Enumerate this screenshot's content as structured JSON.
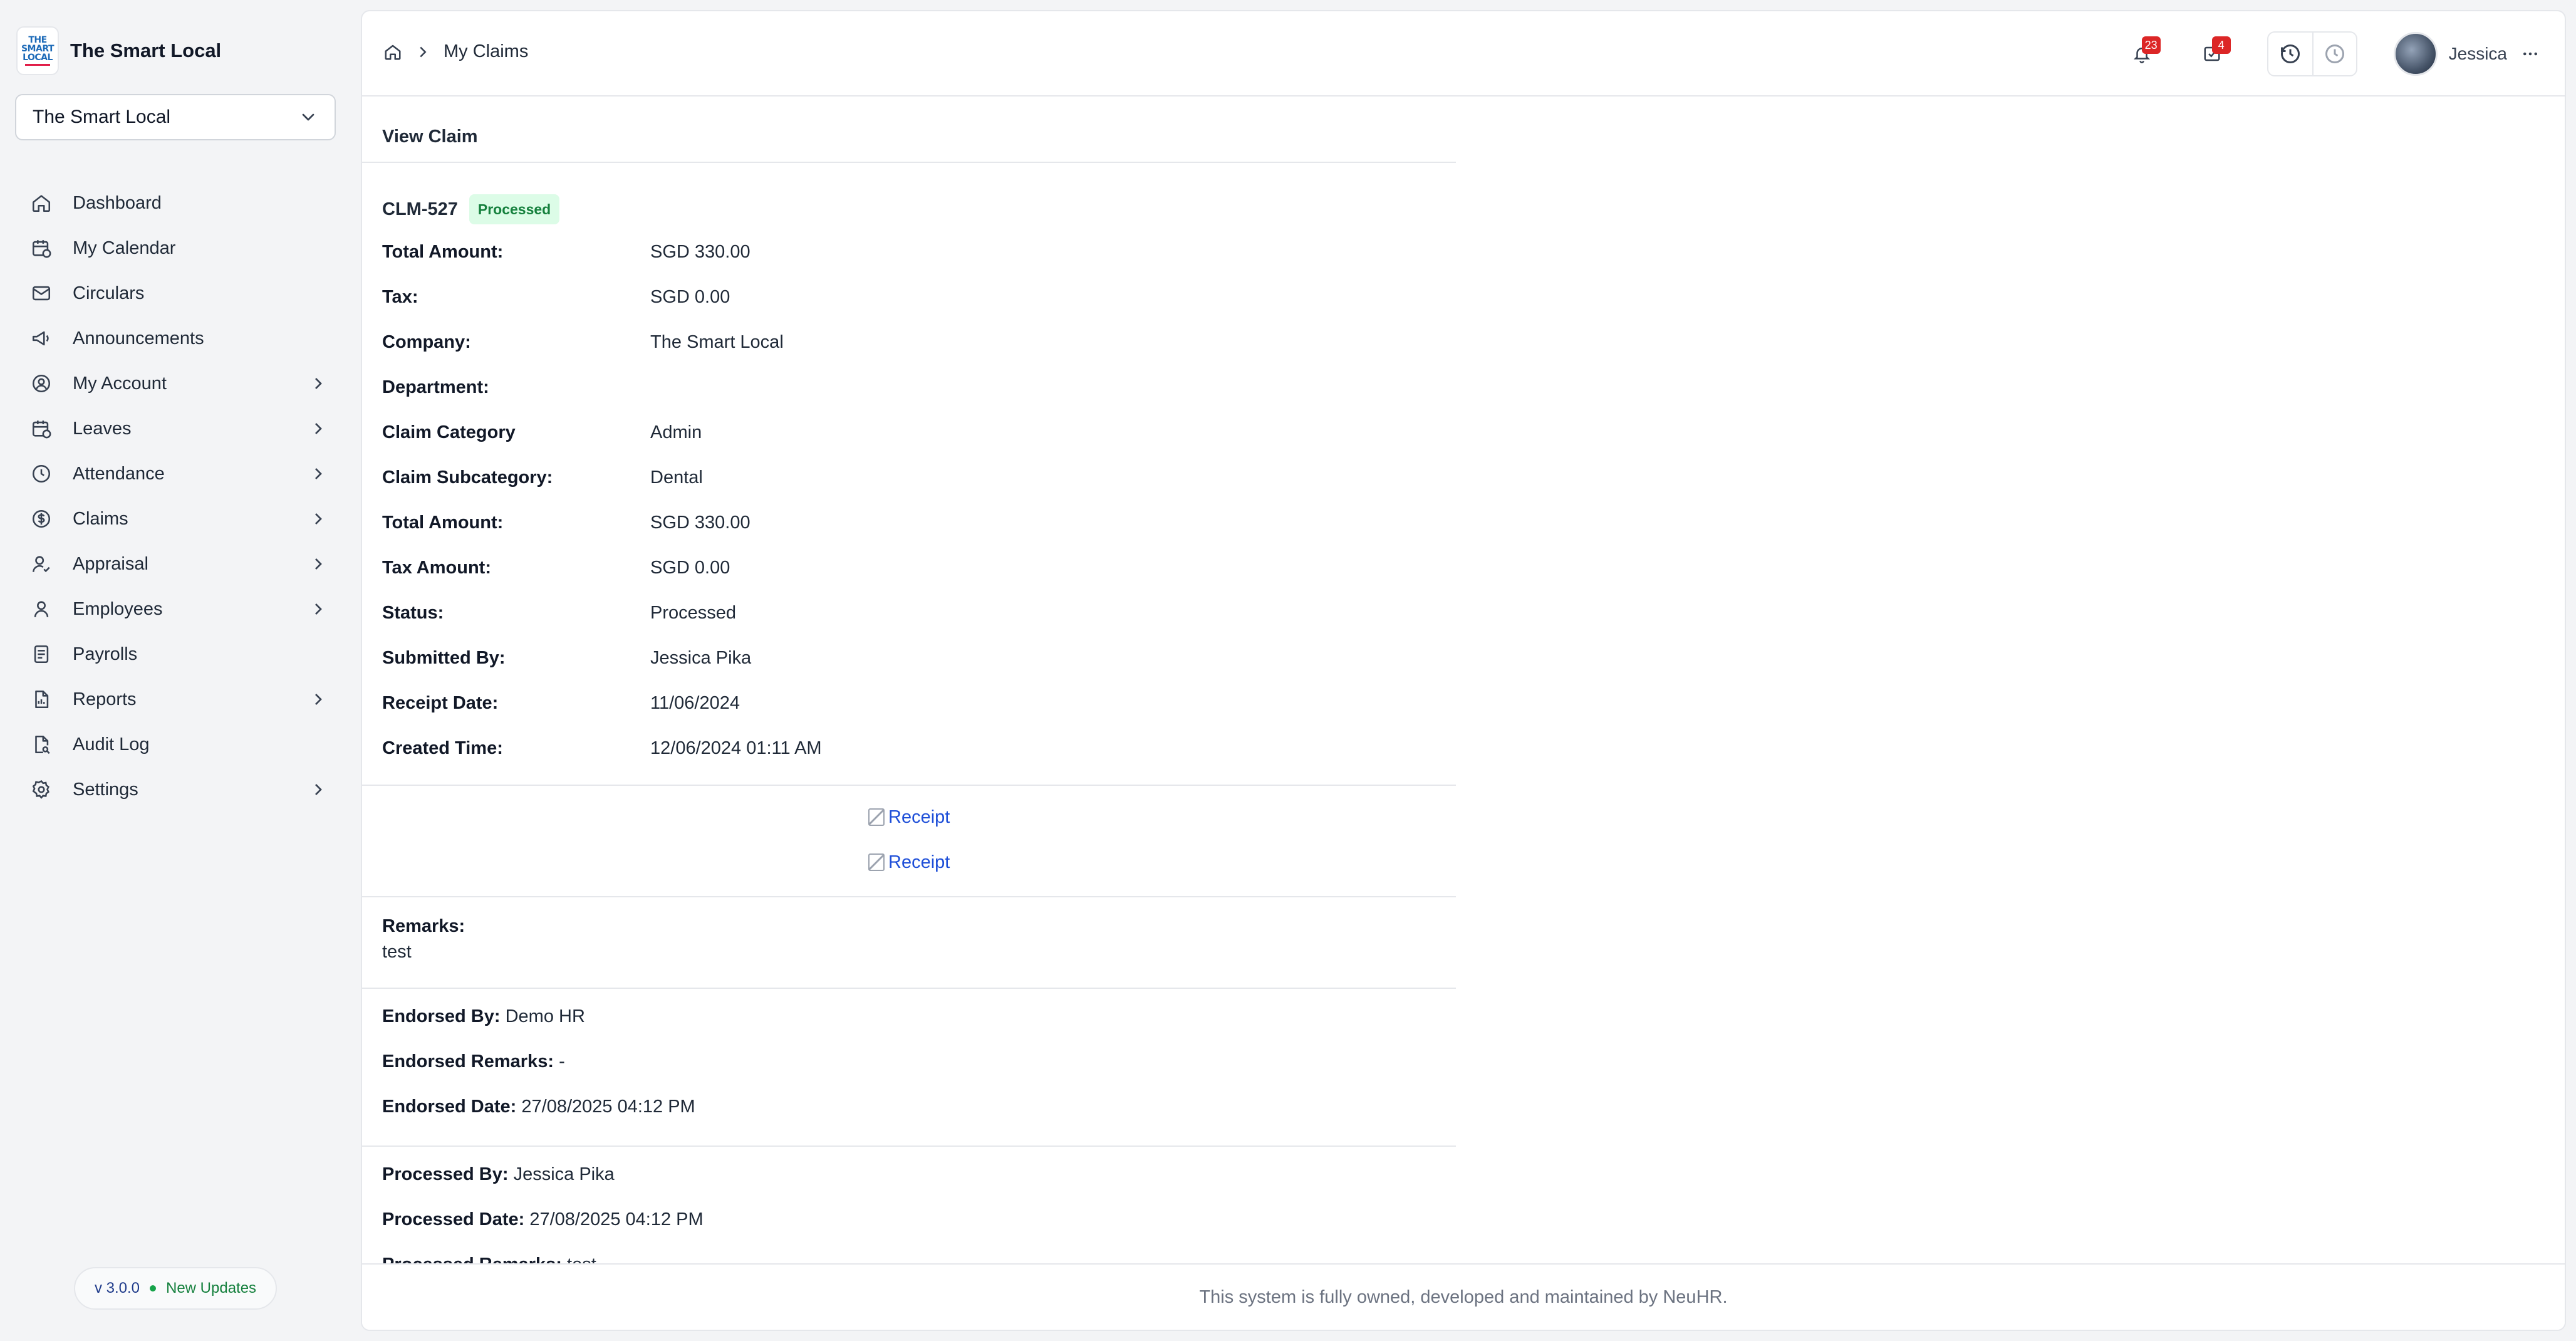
{
  "app": {
    "name": "The Smart Local",
    "logo_text": "THE SMART LOCAL"
  },
  "company_select": {
    "value": "The Smart Local"
  },
  "nav": [
    {
      "label": "Dashboard",
      "icon": "home-icon",
      "has_children": false
    },
    {
      "label": "My Calendar",
      "icon": "calendar-clock-icon",
      "has_children": false
    },
    {
      "label": "Circulars",
      "icon": "mail-icon",
      "has_children": false
    },
    {
      "label": "Announcements",
      "icon": "megaphone-icon",
      "has_children": false
    },
    {
      "label": "My Account",
      "icon": "user-circle-icon",
      "has_children": true
    },
    {
      "label": "Leaves",
      "icon": "calendar-icon",
      "has_children": true
    },
    {
      "label": "Attendance",
      "icon": "clock-icon",
      "has_children": true
    },
    {
      "label": "Claims",
      "icon": "dollar-circle-icon",
      "has_children": true
    },
    {
      "label": "Appraisal",
      "icon": "user-check-icon",
      "has_children": true
    },
    {
      "label": "Employees",
      "icon": "user-icon",
      "has_children": true
    },
    {
      "label": "Payrolls",
      "icon": "receipt-icon",
      "has_children": false
    },
    {
      "label": "Reports",
      "icon": "file-chart-icon",
      "has_children": true
    },
    {
      "label": "Audit Log",
      "icon": "file-search-icon",
      "has_children": false
    },
    {
      "label": "Settings",
      "icon": "gear-icon",
      "has_children": true
    }
  ],
  "version": {
    "number": "v 3.0.0",
    "updates_label": "New Updates"
  },
  "breadcrumb": {
    "current": "My Claims"
  },
  "topbar": {
    "notifications_count": "23",
    "tasks_count": "4",
    "user_name": "Jessica"
  },
  "section_title": "View Claim",
  "claim": {
    "id": "CLM-527",
    "status_badge": "Processed",
    "details": [
      {
        "label": "Total Amount:",
        "value": "SGD 330.00"
      },
      {
        "label": "Tax:",
        "value": "SGD 0.00"
      },
      {
        "label": "Company:",
        "value": "The Smart Local"
      },
      {
        "label": "Department:",
        "value": ""
      },
      {
        "label": "Claim Category",
        "value": "Admin"
      },
      {
        "label": "Claim Subcategory:",
        "value": "Dental"
      },
      {
        "label": "Total Amount:",
        "value": "SGD 330.00"
      },
      {
        "label": "Tax Amount:",
        "value": "SGD 0.00"
      },
      {
        "label": "Status:",
        "value": "Processed"
      },
      {
        "label": "Submitted By:",
        "value": "Jessica Pika"
      },
      {
        "label": "Receipt Date:",
        "value": "11/06/2024"
      },
      {
        "label": "Created Time:",
        "value": "12/06/2024 01:11 AM"
      }
    ],
    "receipts": [
      "Receipt",
      "Receipt"
    ],
    "remarks_label": "Remarks:",
    "remarks": "test",
    "endorsed": [
      {
        "label": "Endorsed By:",
        "value": "Demo HR"
      },
      {
        "label": "Endorsed Remarks:",
        "value": "-"
      },
      {
        "label": "Endorsed Date:",
        "value": "27/08/2025 04:12 PM"
      }
    ],
    "processed": [
      {
        "label": "Processed By:",
        "value": "Jessica Pika"
      },
      {
        "label": "Processed Date:",
        "value": "27/08/2025 04:12 PM"
      },
      {
        "label": "Processed Remarks:",
        "value": "test"
      }
    ]
  },
  "footer": "This system is fully owned, developed and maintained by NeuHR."
}
